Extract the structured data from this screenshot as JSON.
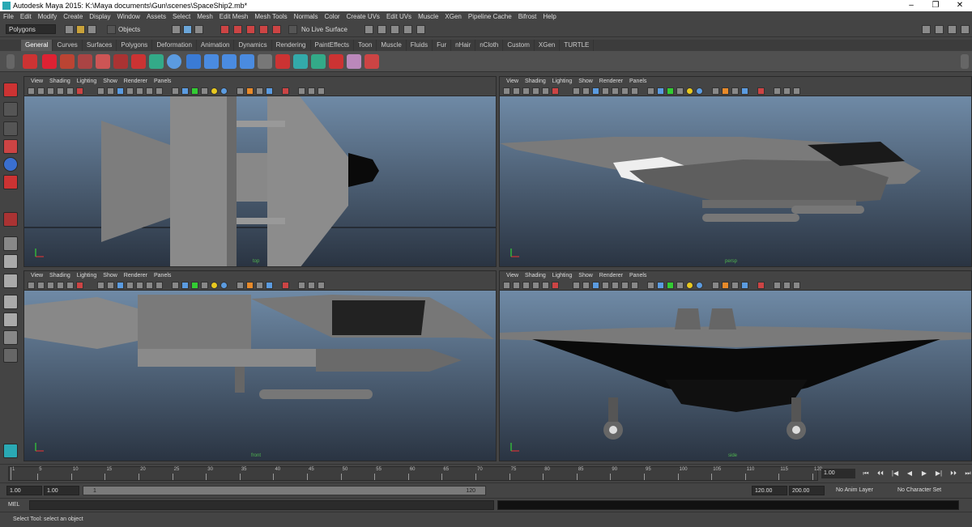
{
  "window": {
    "title": "Autodesk Maya 2015: K:\\Maya documents\\Gun\\scenes\\SpaceShip2.mb*",
    "controls": [
      "–",
      "❐",
      "✕"
    ]
  },
  "menubar": [
    "File",
    "Edit",
    "Modify",
    "Create",
    "Display",
    "Window",
    "Assets",
    "Select",
    "Mesh",
    "Edit Mesh",
    "Mesh Tools",
    "Normals",
    "Color",
    "Create UVs",
    "Edit UVs",
    "Muscle",
    "XGen",
    "Pipeline Cache",
    "Bifrost",
    "Help"
  ],
  "statusline": {
    "mode": "Polygons",
    "selection_mode": "Objects",
    "live_surface": "No Live Surface"
  },
  "shelf_tabs": [
    "General",
    "Curves",
    "Surfaces",
    "Polygons",
    "Deformation",
    "Animation",
    "Dynamics",
    "Rendering",
    "PaintEffects",
    "Toon",
    "Muscle",
    "Fluids",
    "Fur",
    "nHair",
    "nCloth",
    "Custom",
    "XGen",
    "TURTLE"
  ],
  "shelf_active": "General",
  "viewport_menu": [
    "View",
    "Shading",
    "Lighting",
    "Show",
    "Renderer",
    "Panels"
  ],
  "viewports": {
    "top": {
      "camera": "top"
    },
    "persp": {
      "camera": "persp"
    },
    "front": {
      "camera": "front"
    },
    "side": {
      "camera": "side"
    }
  },
  "timeline": {
    "ticks": [
      "1",
      "5",
      "10",
      "15",
      "20",
      "25",
      "30",
      "35",
      "40",
      "45",
      "50",
      "55",
      "60",
      "65",
      "70",
      "75",
      "80",
      "85",
      "90",
      "95",
      "100",
      "105",
      "110",
      "115",
      "120"
    ],
    "current_frame": "1.00",
    "playback": [
      "⏮",
      "⏴⏴",
      "|◀",
      "◀",
      "▶",
      "▶|",
      "⏵⏵",
      "⏭"
    ]
  },
  "range": {
    "start": "1.00",
    "playback_start": "1.00",
    "slider_start": "1",
    "slider_end": "120",
    "playback_end": "120.00",
    "end": "200.00",
    "anim_layer": "No Anim Layer",
    "character_set": "No Character Set"
  },
  "command": {
    "label": "MEL"
  },
  "help": {
    "text": "Select Tool: select an object"
  }
}
